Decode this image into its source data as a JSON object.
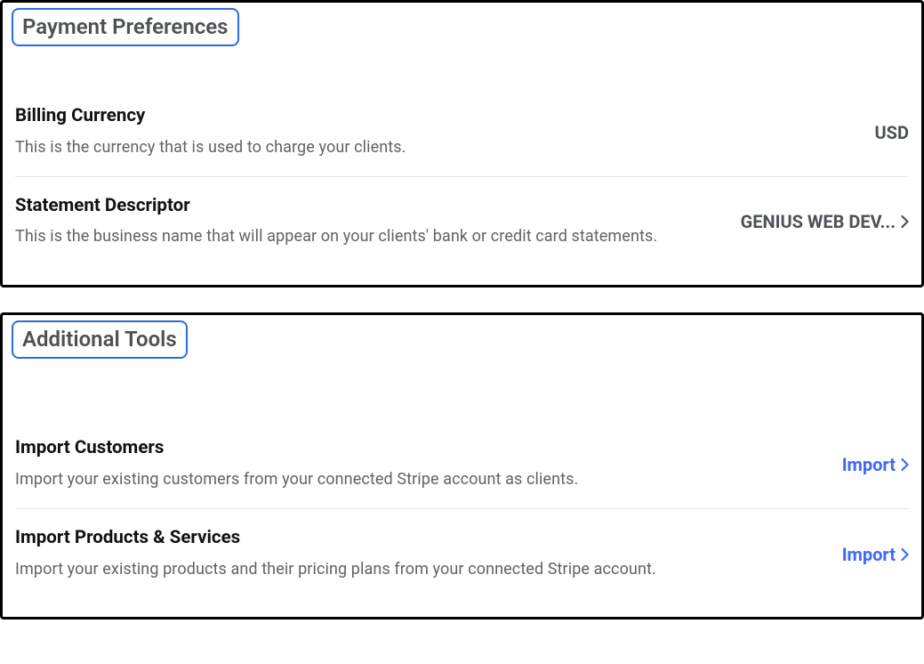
{
  "panels": [
    {
      "title": "Payment Preferences",
      "rows": [
        {
          "title": "Billing Currency",
          "desc": "This is the currency that is used to charge your clients.",
          "value": "USD",
          "action_type": "static"
        },
        {
          "title": "Statement Descriptor",
          "desc": "This is the business name that will appear on your clients' bank or credit card statements.",
          "value": "GENIUS WEB DEV...",
          "action_type": "link-gray"
        }
      ]
    },
    {
      "title": "Additional Tools",
      "rows": [
        {
          "title": "Import Customers",
          "desc": "Import your existing customers from your connected Stripe account as clients.",
          "value": "Import",
          "action_type": "link-blue"
        },
        {
          "title": "Import Products & Services",
          "desc": "Import your existing products and their pricing plans from your connected Stripe account.",
          "value": "Import",
          "action_type": "link-blue"
        }
      ]
    }
  ]
}
